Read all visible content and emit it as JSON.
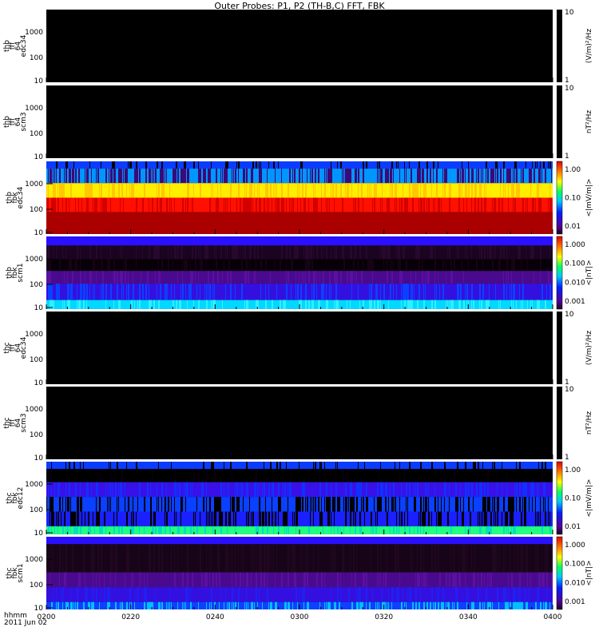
{
  "title": "Outer Probes: P1, P2 (TH-B,C) FFT, FBK",
  "time_axis": {
    "label_line1": "hhmm",
    "label_line2": "2011 Jun 02",
    "ticks": [
      "0200",
      "0220",
      "0240",
      "0300",
      "0320",
      "0340",
      "0400"
    ]
  },
  "chart_data": {
    "type": "heatmap",
    "title": "Outer Probes: P1, P2 (TH-B,C) FFT, FBK",
    "xlabel": "hhmm 2011 Jun 02",
    "xlim": [
      "0200",
      "0400"
    ],
    "panels": [
      {
        "ylabel": [
          "thb",
          "fff",
          "64",
          "edc34"
        ],
        "yticks": [
          "1000",
          "100",
          "10"
        ],
        "zlabel": "(V/m)²/Hz",
        "zticks": [
          "10",
          "1"
        ],
        "kind": "empty",
        "bands": []
      },
      {
        "ylabel": [
          "thb",
          "fff",
          "64",
          "scm3"
        ],
        "yticks": [
          "1000",
          "100",
          "10"
        ],
        "zlabel": "nT²/Hz",
        "zticks": [
          "10",
          "1"
        ],
        "kind": "empty",
        "bands": []
      },
      {
        "ylabel": [
          "thb",
          "fbk",
          "edc34"
        ],
        "yticks": [
          "1000",
          "100",
          "10"
        ],
        "zlabel": "<|mV/m|>",
        "zticks": [
          "1.00",
          "0.10",
          "0.01"
        ],
        "kind": "color",
        "bands": [
          {
            "h": 1,
            "c": "#0a3cff",
            "alt": "#000000",
            "p": 0.25
          },
          {
            "h": 2,
            "c": "#0096ff",
            "alt": "#3a0a78",
            "p": 0.5
          },
          {
            "h": 2,
            "c": "#ffee00",
            "alt": "#ffc800",
            "p": 0.4
          },
          {
            "h": 2,
            "c": "#ff1000",
            "alt": "#d40000",
            "p": 0.4
          },
          {
            "h": 3,
            "c": "#aa0000",
            "alt": "#aa0000",
            "p": 0
          }
        ]
      },
      {
        "ylabel": [
          "thb",
          "fbk",
          "scm1"
        ],
        "yticks": [
          "1000",
          "100",
          "10"
        ],
        "zlabel": "<|nT|>",
        "zticks": [
          "1.000",
          "0.100",
          "0.010",
          "0.001"
        ],
        "kind": "color",
        "bands": [
          {
            "h": 1,
            "c": "#2a10ff",
            "alt": "#2a10ff",
            "p": 0
          },
          {
            "h": 1.5,
            "c": "#1a0420",
            "alt": "#28082e",
            "p": 0.4
          },
          {
            "h": 1.3,
            "c": "#080008",
            "alt": "#140414",
            "p": 0.3
          },
          {
            "h": 1.4,
            "c": "#4a0a8e",
            "alt": "#5a10a0",
            "p": 0.3
          },
          {
            "h": 1.8,
            "c": "#3410e0",
            "alt": "#0a40ff",
            "p": 0.35
          },
          {
            "h": 1,
            "c": "#00d8ff",
            "alt": "#30f0ff",
            "p": 0.3
          }
        ]
      },
      {
        "ylabel": [
          "thc",
          "fff",
          "64",
          "edc34"
        ],
        "yticks": [
          "1000",
          "100",
          "10"
        ],
        "zlabel": "(V/m)²/Hz",
        "zticks": [
          "10",
          "1"
        ],
        "kind": "empty",
        "bands": []
      },
      {
        "ylabel": [
          "thc",
          "fff",
          "64",
          "scm3"
        ],
        "yticks": [
          "1000",
          "100",
          "10"
        ],
        "zlabel": "nT²/Hz",
        "zticks": [
          "10",
          "1"
        ],
        "kind": "empty",
        "bands": []
      },
      {
        "ylabel": [
          "thc",
          "fbk",
          "edc12"
        ],
        "yticks": [
          "1000",
          "100",
          "10"
        ],
        "zlabel": "<|mV/m|>",
        "zticks": [
          "1.00",
          "0.10",
          "0.01"
        ],
        "kind": "color",
        "bands": [
          {
            "h": 1,
            "c": "#0a3cff",
            "alt": "#000000",
            "p": 0.15
          },
          {
            "h": 1.8,
            "c": "#000000",
            "alt": "#0a0010",
            "p": 0.1
          },
          {
            "h": 2,
            "c": "#3a10e8",
            "alt": "#1030ff",
            "p": 0.4
          },
          {
            "h": 2,
            "c": "#0a40ff",
            "alt": "#000000",
            "p": 0.45
          },
          {
            "h": 2,
            "c": "#1a20ff",
            "alt": "#000000",
            "p": 0.45
          },
          {
            "h": 1.1,
            "c": "#20ff80",
            "alt": "#00e0c0",
            "p": 0.3
          }
        ]
      },
      {
        "ylabel": [
          "thc",
          "fbk",
          "scm1"
        ],
        "yticks": [
          "1000",
          "100",
          "10"
        ],
        "zlabel": "<|nT|>",
        "zticks": [
          "1.000",
          "0.100",
          "0.010",
          "0.001"
        ],
        "kind": "color",
        "bands": [
          {
            "h": 1,
            "c": "#2a10ff",
            "alt": "#2a10ff",
            "p": 0
          },
          {
            "h": 3.8,
            "c": "#180418",
            "alt": "#200820",
            "p": 0.3
          },
          {
            "h": 2,
            "c": "#4a0a8e",
            "alt": "#5a10a0",
            "p": 0.3
          },
          {
            "h": 2,
            "c": "#3410e0",
            "alt": "#2020f0",
            "p": 0.3
          },
          {
            "h": 1,
            "c": "#1040ff",
            "alt": "#00c0ff",
            "p": 0.5
          }
        ]
      }
    ]
  }
}
